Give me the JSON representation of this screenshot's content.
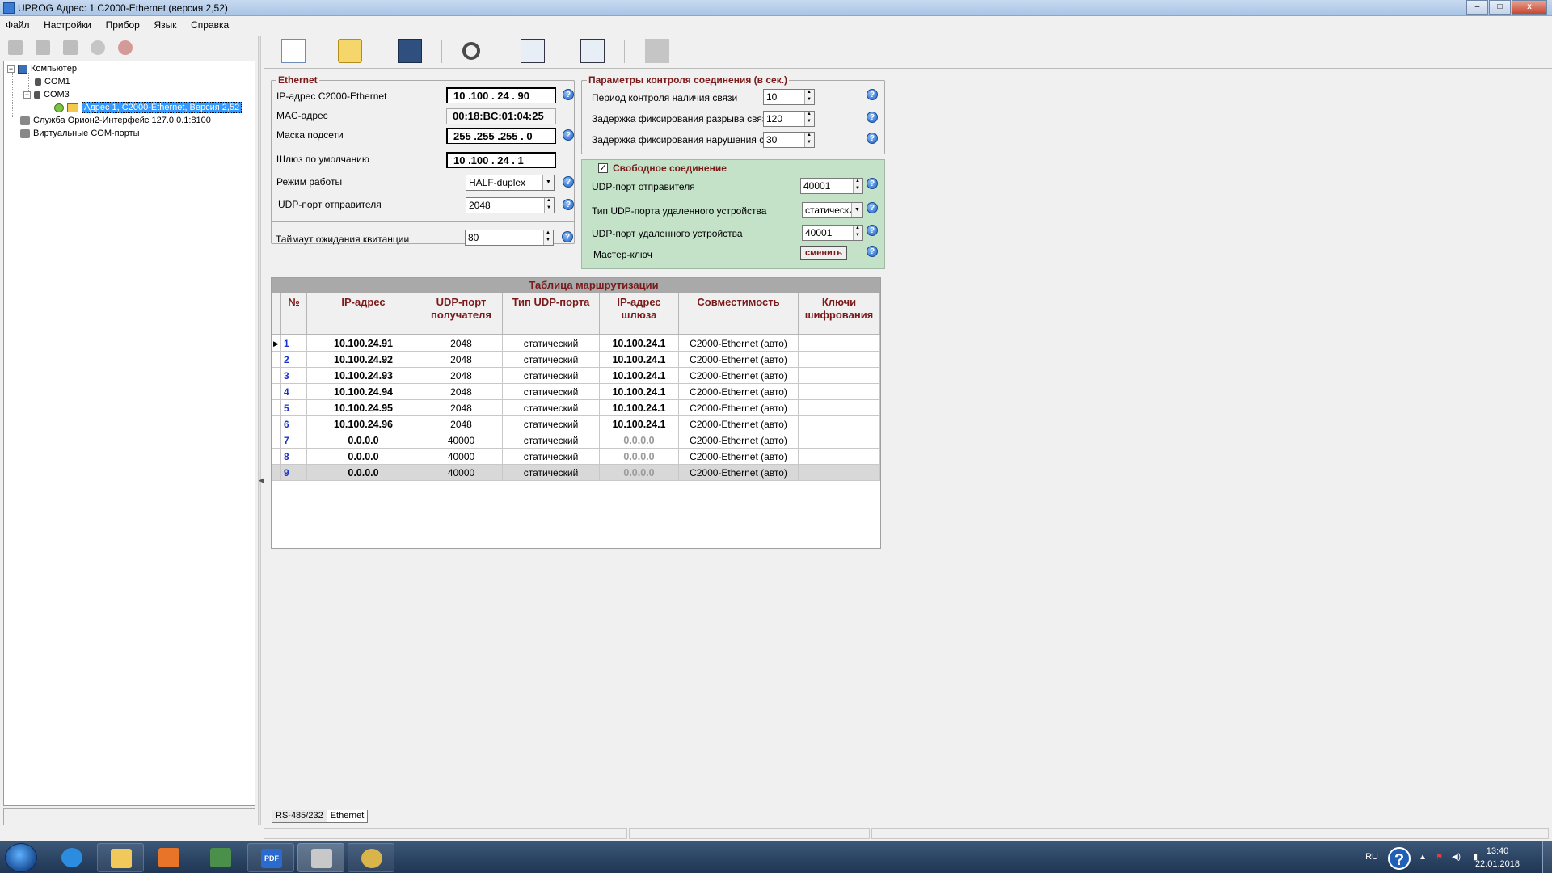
{
  "window": {
    "title": "UPROG  Адрес:  1  С2000-Ethernet (версия  2,52)",
    "buttons": [
      "–",
      "□",
      "x"
    ]
  },
  "menu": [
    "Файл",
    "Настройки",
    "Прибор",
    "Язык",
    "Справка"
  ],
  "tree": {
    "root": "Компьютер",
    "com1": "COM1",
    "com3": "COM3",
    "device": "Адрес 1, С2000-Ethernet, Версия 2,52",
    "service": "Служба Орион2-Интерфейс 127.0.0.1:8100",
    "virtual": "Виртуальные COM-порты"
  },
  "ethernet": {
    "title": "Ethernet",
    "ip_label": "IP-адрес С2000-Ethernet",
    "ip_value": "10 .100 . 24 . 90",
    "mac_label": "MAC-адрес",
    "mac_value": "00:18:BC:01:04:25",
    "mask_label": "Маска подсети",
    "mask_value": "255 .255 .255 .  0",
    "gateway_label": "Шлюз по умолчанию",
    "gateway_value": "10 .100 . 24 .  1",
    "mode_label": "Режим работы",
    "mode_value": "HALF-duplex",
    "udp_label": "UDP-порт отправителя",
    "udp_value": "2048",
    "timeout_label": "Таймаут ожидания квитанции",
    "timeout_value": "80"
  },
  "connection": {
    "title": "Параметры контроля соединения (в сек.)",
    "period_label": "Период контроля наличия связи",
    "period_value": "10",
    "break_label": "Задержка фиксирования разрыва связи",
    "break_value": "120",
    "violation_label": "Задержка фиксирования нарушения связи",
    "violation_value": "30"
  },
  "free_connection": {
    "title": "Свободное соединение",
    "checked": true,
    "check_mark": "✓",
    "udp_sender_label": "UDP-порт отправителя",
    "udp_sender_value": "40001",
    "remote_type_label": "Тип UDP-порта удаленного устройства",
    "remote_type_value": "статический",
    "remote_port_label": "UDP-порт удаленного устройства",
    "remote_port_value": "40001",
    "master_key_label": "Мастер-ключ",
    "change_button": "сменить"
  },
  "routing_table": {
    "title": "Таблица маршрутизации",
    "headers": {
      "num": "№",
      "ip": "IP-адрес",
      "udp1": "UDP-порт",
      "udp2": "получателя",
      "type": "Тип UDP-порта",
      "gw1": "IP-адрес",
      "gw2": "шлюза",
      "compat": "Совместимость",
      "keys1": "Ключи",
      "keys2": "шифрования"
    },
    "rows": [
      {
        "n": "1",
        "ip": "10.100.24.91",
        "port": "2048",
        "type": "статический",
        "gw": "10.100.24.1",
        "compat": "С2000-Ethernet (авто)",
        "keys": ""
      },
      {
        "n": "2",
        "ip": "10.100.24.92",
        "port": "2048",
        "type": "статический",
        "gw": "10.100.24.1",
        "compat": "С2000-Ethernet (авто)",
        "keys": ""
      },
      {
        "n": "3",
        "ip": "10.100.24.93",
        "port": "2048",
        "type": "статический",
        "gw": "10.100.24.1",
        "compat": "С2000-Ethernet (авто)",
        "keys": ""
      },
      {
        "n": "4",
        "ip": "10.100.24.94",
        "port": "2048",
        "type": "статический",
        "gw": "10.100.24.1",
        "compat": "С2000-Ethernet (авто)",
        "keys": ""
      },
      {
        "n": "5",
        "ip": "10.100.24.95",
        "port": "2048",
        "type": "статический",
        "gw": "10.100.24.1",
        "compat": "С2000-Ethernet (авто)",
        "keys": ""
      },
      {
        "n": "6",
        "ip": "10.100.24.96",
        "port": "2048",
        "type": "статический",
        "gw": "10.100.24.1",
        "compat": "С2000-Ethernet (авто)",
        "keys": ""
      },
      {
        "n": "7",
        "ip": "0.0.0.0",
        "port": "40000",
        "type": "статический",
        "gw": "0.0.0.0",
        "compat": "С2000-Ethernet (авто)",
        "keys": ""
      },
      {
        "n": "8",
        "ip": "0.0.0.0",
        "port": "40000",
        "type": "статический",
        "gw": "0.0.0.0",
        "compat": "С2000-Ethernet (авто)",
        "keys": ""
      },
      {
        "n": "9",
        "ip": "0.0.0.0",
        "port": "40000",
        "type": "статический",
        "gw": "0.0.0.0",
        "compat": "С2000-Ethernet (авто)",
        "keys": ""
      }
    ]
  },
  "tabs": [
    "RS-485/232",
    "Ethernet"
  ],
  "taskbar": {
    "lang": "RU",
    "help": "?",
    "time": "13:40",
    "date": "22.01.2018",
    "pdf": "PDF"
  },
  "colors": {
    "accent": "#7a1a1a",
    "row_number": "#1a33c8",
    "free_connection_bg": "#c3e2c8",
    "selection": "#3399ff"
  }
}
